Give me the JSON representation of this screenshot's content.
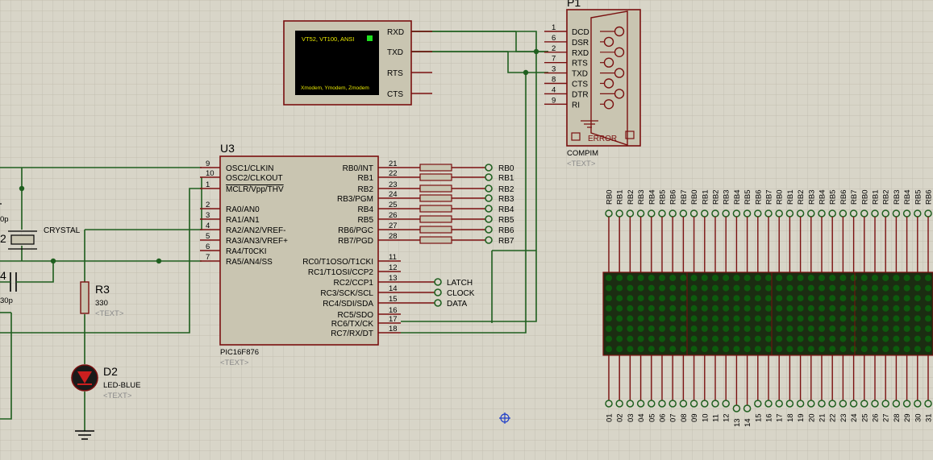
{
  "terminal": {
    "banner": "VT52, VT100, ANSI",
    "footer": "Xmodem, Ymodem, Zmodem",
    "pins": [
      "RXD",
      "TXD",
      "RTS",
      "CTS"
    ]
  },
  "compim": {
    "ref": "P1",
    "name": "COMPIM",
    "text": "<TEXT>",
    "error": "ERROR",
    "pins": [
      {
        "num": "1",
        "name": "DCD"
      },
      {
        "num": "6",
        "name": "DSR"
      },
      {
        "num": "2",
        "name": "RXD"
      },
      {
        "num": "7",
        "name": "RTS"
      },
      {
        "num": "3",
        "name": "TXD"
      },
      {
        "num": "8",
        "name": "CTS"
      },
      {
        "num": "4",
        "name": "DTR"
      },
      {
        "num": "9",
        "name": "RI"
      }
    ]
  },
  "mcu": {
    "ref": "U3",
    "part": "PIC16F876",
    "text": "<TEXT>",
    "left_pins": [
      {
        "num": "9",
        "name": "OSC1/CLKIN"
      },
      {
        "num": "10",
        "name": "OSC2/CLKOUT"
      },
      {
        "num": "1",
        "name": "MCLR/Vpp/THV"
      },
      {
        "num": "2",
        "name": "RA0/AN0"
      },
      {
        "num": "3",
        "name": "RA1/AN1"
      },
      {
        "num": "4",
        "name": "RA2/AN2/VREF-"
      },
      {
        "num": "5",
        "name": "RA3/AN3/VREF+"
      },
      {
        "num": "6",
        "name": "RA4/T0CKI"
      },
      {
        "num": "7",
        "name": "RA5/AN4/SS"
      }
    ],
    "right_pins": [
      {
        "num": "21",
        "name": "RB0/INT"
      },
      {
        "num": "22",
        "name": "RB1"
      },
      {
        "num": "23",
        "name": "RB2"
      },
      {
        "num": "24",
        "name": "RB3/PGM"
      },
      {
        "num": "25",
        "name": "RB4"
      },
      {
        "num": "26",
        "name": "RB5"
      },
      {
        "num": "27",
        "name": "RB6/PGC"
      },
      {
        "num": "28",
        "name": "RB7/PGD"
      },
      {
        "num": "11",
        "name": "RC0/T1OSO/T1CKI"
      },
      {
        "num": "12",
        "name": "RC1/T1OSI/CCP2"
      },
      {
        "num": "13",
        "name": "RC2/CCP1"
      },
      {
        "num": "14",
        "name": "RC3/SCK/SCL"
      },
      {
        "num": "15",
        "name": "RC4/SDI/SDA"
      },
      {
        "num": "16",
        "name": "RC5/SDO"
      },
      {
        "num": "17",
        "name": "RC6/TX/CK"
      },
      {
        "num": "18",
        "name": "RC7/RX/DT"
      }
    ]
  },
  "rb_terminals": [
    "RB0",
    "RB1",
    "RB2",
    "RB3",
    "RB4",
    "RB5",
    "RB6",
    "RB7"
  ],
  "rc_terminals": [
    "LATCH",
    "CLOCK",
    "DATA"
  ],
  "crystal": {
    "label": "CRYSTAL",
    "ref_partial": "2"
  },
  "caps": {
    "c_top_value": "0p",
    "c_bottom_ref": "4",
    "c_bottom_value": "30p"
  },
  "resistor": {
    "ref": "R3",
    "value": "330",
    "text": "<TEXT>"
  },
  "led": {
    "ref": "D2",
    "part": "LED-BLUE",
    "text": "<TEXT>"
  },
  "matrix_top_labels": [
    "RB0",
    "RB1",
    "RB2",
    "RB3",
    "RB4",
    "RB5",
    "RB6",
    "RB7",
    "RB0",
    "RB1",
    "RB2",
    "RB3",
    "RB4",
    "RB5",
    "RB6",
    "RB7",
    "RB0",
    "RB1",
    "RB2",
    "RB3",
    "RB4",
    "RB5",
    "RB6",
    "RB7",
    "RB0",
    "RB1",
    "RB2",
    "RB3",
    "RB4",
    "RB5",
    "RB6",
    "RB7"
  ],
  "matrix_bottom_labels": [
    "01",
    "02",
    "03",
    "04",
    "05",
    "06",
    "07",
    "08",
    "09",
    "10",
    "11",
    "12",
    "13",
    "14",
    "15",
    "16",
    "17",
    "18",
    "19",
    "20",
    "21",
    "22",
    "23",
    "24",
    "25",
    "26",
    "27",
    "28",
    "29",
    "30",
    "31",
    "32"
  ]
}
